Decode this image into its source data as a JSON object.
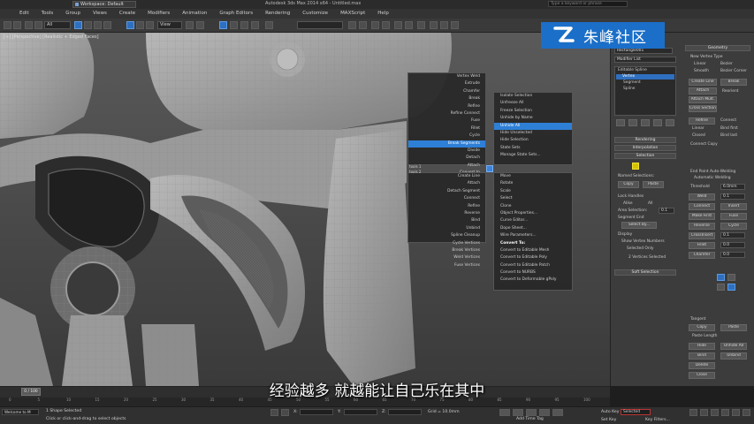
{
  "titlebar": {
    "workspace": "Workspace: Default",
    "title": "Autodesk 3ds Max 2014 x64 - Untitled.max",
    "search_placeholder": "Type a keyword or phrase"
  },
  "menu": [
    "Edit",
    "Tools",
    "Group",
    "Views",
    "Create",
    "Modifiers",
    "Animation",
    "Graph Editors",
    "Rendering",
    "Customize",
    "MAXScript",
    "Help"
  ],
  "toolbar": {
    "filter_value": "All",
    "view_value": "View",
    "selection_set_value": ""
  },
  "viewport": {
    "label": "[+] [Perspective] [Realistic + Edged Faces]"
  },
  "watermark": {
    "text": "朱峰社区"
  },
  "quad": {
    "upper_left": [
      "Vertex Weld",
      "Extrude",
      "Chamfer",
      "Break",
      "Refine",
      "Refine Connect",
      "Fuse",
      "Fillet",
      "Cycle",
      "Break Segments",
      "Divide",
      "Detach",
      "Attach",
      "Convert to"
    ],
    "upper_left_hl": "Break Segments",
    "upper_right": [
      "Isolate Selection",
      "Unfreeze All",
      "Freeze Selection",
      "Unhide by Name",
      "Unhide All",
      "Hide Unselected",
      "Hide Selection",
      "State Sets",
      "Manage State Sets..."
    ],
    "upper_right_hl": "Unhide All",
    "upper_right_headers": [
      "display",
      "transform"
    ],
    "labels": {
      "left_mid": "tools 1",
      "right_mid": "tools 2"
    },
    "lower_left": [
      "Create Line",
      "Attach",
      "Detach Segment",
      "Connect",
      "Refine",
      "Reverse",
      "Bind",
      "Unbind",
      "Spline Cleanup",
      "Cycle Vertices",
      "Break Vertices",
      "Weld Vertices",
      "Fuse Vertices"
    ],
    "lower_right": [
      "Move",
      "Rotate",
      "Scale",
      "Select",
      "Clone",
      "Object Properties...",
      "Curve Editor...",
      "Dope Sheet...",
      "Wire Parameters...",
      "Convert To:",
      "Convert to Editable Mesh",
      "Convert to Editable Poly",
      "Convert to Editable Patch",
      "Convert to NURBS",
      "Convert to Deformable gPoly"
    ],
    "lower_right_hdr": "Convert To:"
  },
  "cmdpanel": {
    "name_field": "Rectangle001",
    "modifier_list": "Modifier List",
    "stack": [
      "Editable Spline",
      "Vertex",
      "Segment",
      "Spline"
    ],
    "stack_selected": "Vertex",
    "geometry_title": "Geometry",
    "new_vertex_type": "New Vertex Type",
    "vertex_types": [
      "Linear",
      "Bezier",
      "Smooth",
      "Bezier Corner"
    ],
    "create_line": "Create Line",
    "break": "Break",
    "attach": "Attach",
    "reorient": "Reorient",
    "attach_mult": "Attach Mult.",
    "cross_section": "Cross Section",
    "refine": "Refine",
    "connect": "Connect",
    "linear": "Linear",
    "bind_first": "Bind first",
    "closed": "Closed",
    "bind_last": "Bind last",
    "connect_copy": "Connect Copy",
    "end_point_title": "End Point Auto-Welding",
    "auto_welding": "Automatic Welding",
    "threshold_label": "Threshold",
    "threshold_value": "6.0mm",
    "weld": "Weld",
    "weld_value": "0.1",
    "connect2": "Connect",
    "insert": "Insert",
    "make_first": "Make First",
    "fuse": "Fuse",
    "reverse": "Reverse",
    "cycle": "Cycle",
    "crossinsert": "CrossInsert",
    "crossinsert_value": "0.1",
    "fillet": "Fillet",
    "fillet_value": "0.0",
    "chamfer": "Chamfer",
    "chamfer_value": "0.0",
    "rollouts": [
      "Rendering",
      "Interpolation",
      "Selection",
      "Soft Selection"
    ],
    "named_sel": "Named Selections:",
    "copy": "Copy",
    "paste": "Paste",
    "lock_handles": "Lock Handles",
    "alike": "Alike",
    "all": "All",
    "area_selection": "Area Selection:",
    "area_value": "0.1",
    "segment_end": "Segment End",
    "select_by": "Select By...",
    "display": "Display",
    "show_vertex_numbers": "Show Vertex Numbers",
    "selected_only": "Selected Only",
    "selection_status": "2 Vertices Selected",
    "tangent": "Tangent",
    "copy2": "Copy",
    "paste2": "Paste",
    "paste_length": "Paste Length",
    "hide": "Hide",
    "unhide_all": "Unhide All",
    "bind": "Bind",
    "unbind": "Unbind",
    "delete": "Delete",
    "close": "Close"
  },
  "subtitle": "经验越多 就越能让自己乐在其中",
  "timeline": {
    "slider": "0 / 100"
  },
  "trackbar_ticks": [
    "0",
    "5",
    "10",
    "15",
    "20",
    "25",
    "30",
    "35",
    "40",
    "45",
    "50",
    "55",
    "60",
    "65",
    "70",
    "75",
    "80",
    "85",
    "90",
    "95",
    "100"
  ],
  "status": {
    "shape_selected": "1 Shape Selected",
    "prompt": "Click or click-and-drag to select objects",
    "welcome": "Welcome to M",
    "x_label": "X:",
    "y_label": "Y:",
    "z_label": "Z:",
    "grid": "Grid = 10.0mm",
    "auto_key": "Auto Key",
    "selected": "Selected",
    "set_key": "Set Key",
    "key_filters": "Key Filters...",
    "add_time_tag": "Add Time Tag"
  }
}
